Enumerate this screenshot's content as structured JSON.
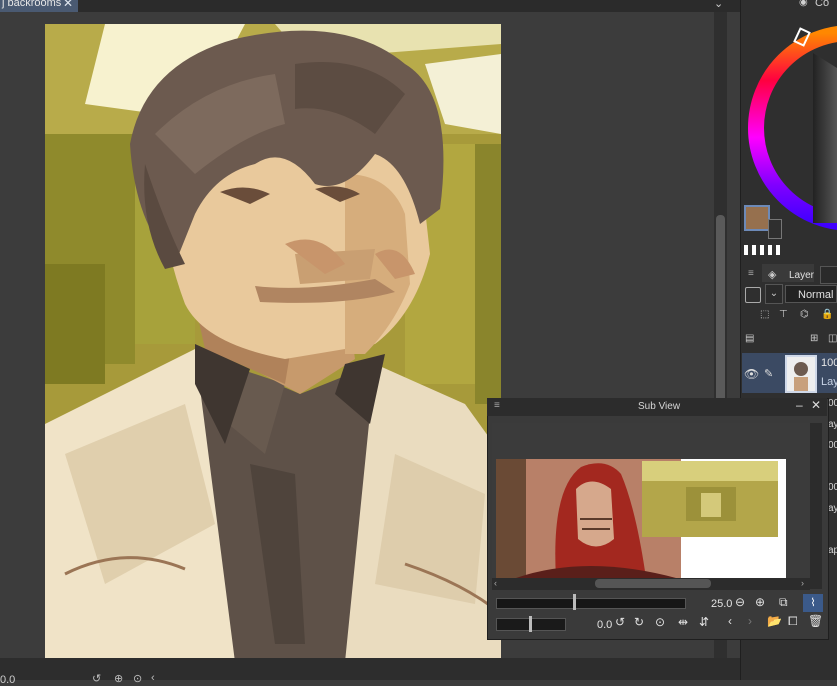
{
  "tab": {
    "title": "j backrooms",
    "close_glyph": "✕"
  },
  "canvas": {
    "artwork": "digital painting of a man in a white coat with distorted doubled face, yellow backrooms background"
  },
  "status": {
    "zoom": "0.0"
  },
  "right_panel": {
    "color_title": "Co",
    "main_color": "#96704e",
    "layer_tab_label": "Layer",
    "blend_mode": "Normal",
    "layer_name": "100",
    "layer_sub": "Lay",
    "truncated_rows": [
      "00",
      "ay",
      "00",
      "00",
      "ay",
      "ap"
    ]
  },
  "sub_view": {
    "title": "Sub View",
    "zoom_value": "25.0",
    "rotate_value": "0.0"
  }
}
